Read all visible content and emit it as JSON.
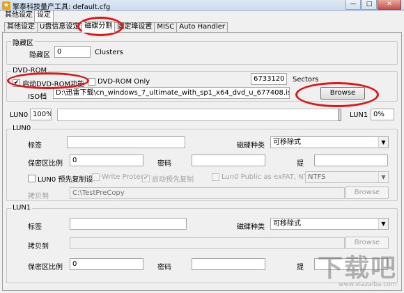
{
  "window": {
    "title": "擎泰科技量产工具: default.cfg",
    "buttons": [
      "—",
      "□",
      "✕"
    ]
  },
  "top_tabs": [
    "其他设定",
    "设定"
  ],
  "sub_tabs": [
    "其他设定",
    "U盘信息设定",
    "磁碟分割",
    "固定埠设置",
    "MISC",
    "Auto Handler"
  ],
  "hidden": {
    "group": "隐藏区",
    "label": "隐藏区",
    "value": "0",
    "unit": "Clusters"
  },
  "dvd": {
    "group": "DVD-ROM",
    "enable_label": "启动DVD-ROM功能",
    "enable_checked": true,
    "only_label": "DVD-ROM Only",
    "only_checked": false,
    "sectors_value": "6733120",
    "sectors_label": "Sectors",
    "iso_label": "ISO档",
    "iso_path": "D:\\迅雷下载\\cn_windows_7_ultimate_with_sp1_x64_dvd_u_677408.iso",
    "browse": "Browse"
  },
  "lun_split": {
    "lun0_label": "LUN0",
    "lun0_value": "100%",
    "lun1_label": "LUN1",
    "lun1_value": "0%",
    "lun0_fraction": 1.0
  },
  "lun0": {
    "group": "LUN0",
    "label_label": "标签",
    "label_value": "",
    "disk_type_label": "磁碟种类",
    "disk_type_value": "可移除式",
    "secure_ratio_label": "保密区比例",
    "secure_ratio_value": "0",
    "password_label": "密码",
    "password_value": "",
    "hint_label": "提",
    "hint_value": "",
    "precopy_label": "LUN0 预先复制设",
    "precopy_checked": false,
    "write_protect_label": "Write Protect",
    "write_protect_checked": false,
    "auto_precopy_label": "启动预先复制",
    "auto_precopy_checked": true,
    "public_exfat_label": "Lun0 Public as exFAT, NTFS",
    "public_exfat_checked": false,
    "fs_value": "NTFS",
    "copy_to_label": "拷贝到",
    "copy_to_value": "C:\\TestPreCopy",
    "browse": "Browse"
  },
  "lun1": {
    "group": "LUN1",
    "label_label": "标签",
    "label_value": "",
    "disk_type_label": "磁碟种类",
    "disk_type_value": "可移除式",
    "copy_to_label": "拷贝到",
    "copy_to_value": "",
    "browse": "Browse",
    "secure_ratio_label": "保密区比例",
    "secure_ratio_value": "0",
    "password_label": "密码",
    "password_value": "",
    "hint_label": "提",
    "hint_value": ""
  },
  "watermark": {
    "text": "下载吧",
    "url": "www.xiazaiba.com"
  }
}
